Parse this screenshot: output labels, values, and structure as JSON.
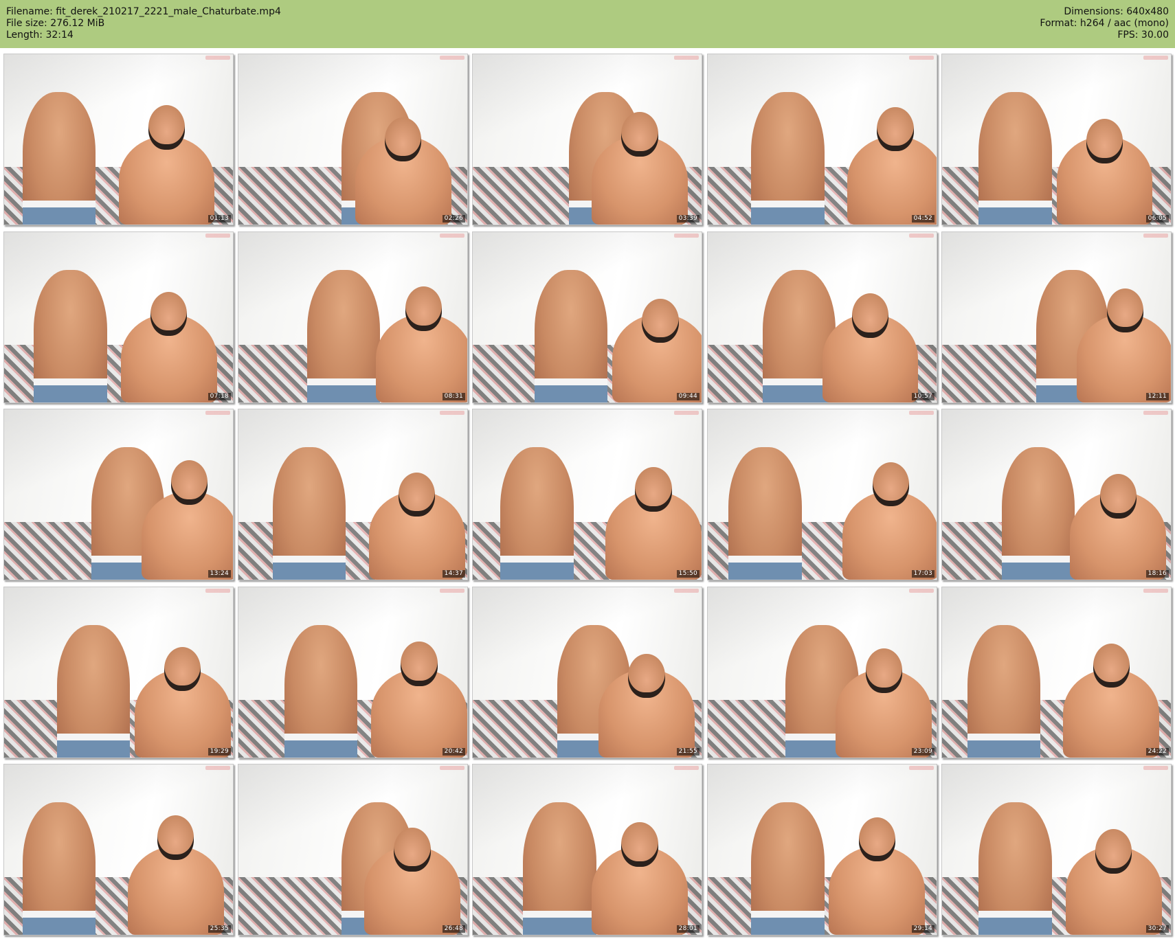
{
  "header": {
    "filename": "Filename: fit_derek_210217_2221_male_Chaturbate.mp4",
    "filesize": "File size: 276.12 MiB",
    "length": "Length: 32:14",
    "dimensions": "Dimensions: 640x480",
    "format": "Format: h264 / aac (mono)",
    "fps": "FPS: 30.00"
  },
  "colors": {
    "header_bg": "#aecb80",
    "timestamp_bg": "#000000"
  },
  "thumbnails": [
    "01:13",
    "02:26",
    "03:39",
    "04:52",
    "06:05",
    "07:18",
    "08:31",
    "09:44",
    "10:57",
    "12:11",
    "13:24",
    "14:37",
    "15:50",
    "17:03",
    "18:16",
    "19:29",
    "20:42",
    "21:55",
    "23:09",
    "24:22",
    "25:35",
    "26:48",
    "28:01",
    "29:14",
    "30:27"
  ]
}
